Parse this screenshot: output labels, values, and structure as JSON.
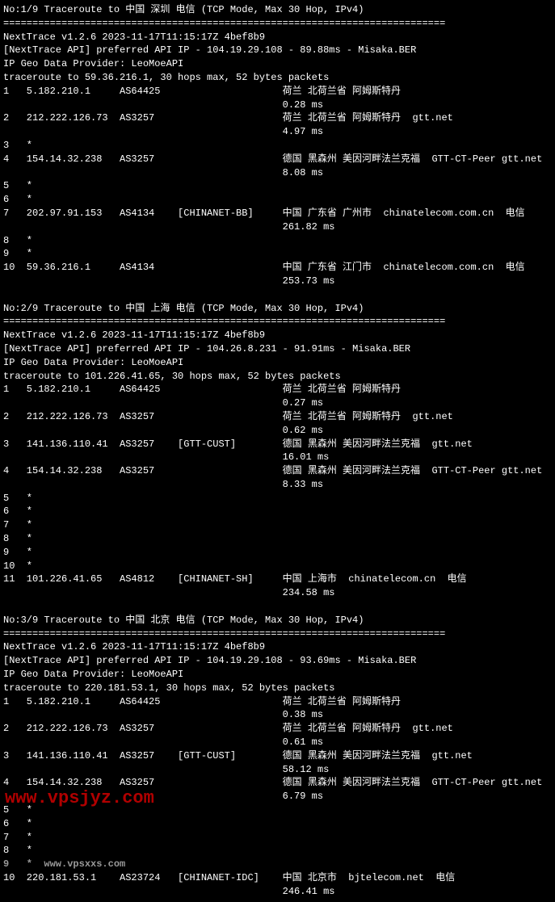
{
  "divider": "============================================================================",
  "traces": [
    {
      "header": "No:1/9 Traceroute to 中国 深圳 电信 (TCP Mode, Max 30 Hop, IPv4)",
      "version": "NextTrace v1.2.6 2023-11-17T11:15:17Z 4bef8b9",
      "api": "[NextTrace API] preferred API IP - 104.19.29.108 - 89.88ms - Misaka.BER",
      "geo": "IP Geo Data Provider: LeoMoeAPI",
      "cmd": "traceroute to 59.36.216.1, 30 hops max, 52 bytes packets",
      "hops": [
        {
          "n": "1",
          "ip": "5.182.210.1",
          "as": "AS64425",
          "tag": "",
          "loc": "荷兰 北荷兰省 阿姆斯特丹",
          "isp": "",
          "ms": "0.28 ms"
        },
        {
          "n": "2",
          "ip": "212.222.126.73",
          "as": "AS3257",
          "tag": "",
          "loc": "荷兰 北荷兰省 阿姆斯特丹",
          "isp": "gtt.net",
          "ms": "4.97 ms"
        },
        {
          "n": "3",
          "ip": "*",
          "as": "",
          "tag": "",
          "loc": "",
          "isp": "",
          "ms": ""
        },
        {
          "n": "4",
          "ip": "154.14.32.238",
          "as": "AS3257",
          "tag": "",
          "loc": "德国 黑森州 美因河畔法兰克福",
          "isp": "GTT-CT-Peer gtt.net",
          "ms": "8.08 ms"
        },
        {
          "n": "5",
          "ip": "*",
          "as": "",
          "tag": "",
          "loc": "",
          "isp": "",
          "ms": ""
        },
        {
          "n": "6",
          "ip": "*",
          "as": "",
          "tag": "",
          "loc": "",
          "isp": "",
          "ms": ""
        },
        {
          "n": "7",
          "ip": "202.97.91.153",
          "as": "AS4134",
          "tag": "[CHINANET-BB]",
          "loc": "中国 广东省 广州市",
          "isp": "chinatelecom.com.cn  电信",
          "ms": "261.82 ms"
        },
        {
          "n": "8",
          "ip": "*",
          "as": "",
          "tag": "",
          "loc": "",
          "isp": "",
          "ms": ""
        },
        {
          "n": "9",
          "ip": "*",
          "as": "",
          "tag": "",
          "loc": "",
          "isp": "",
          "ms": ""
        },
        {
          "n": "10",
          "ip": "59.36.216.1",
          "as": "AS4134",
          "tag": "",
          "loc": "中国 广东省 江门市",
          "isp": "chinatelecom.com.cn  电信",
          "ms": "253.73 ms"
        }
      ]
    },
    {
      "header": "No:2/9 Traceroute to 中国 上海 电信 (TCP Mode, Max 30 Hop, IPv4)",
      "version": "NextTrace v1.2.6 2023-11-17T11:15:17Z 4bef8b9",
      "api": "[NextTrace API] preferred API IP - 104.26.8.231 - 91.91ms - Misaka.BER",
      "geo": "IP Geo Data Provider: LeoMoeAPI",
      "cmd": "traceroute to 101.226.41.65, 30 hops max, 52 bytes packets",
      "hops": [
        {
          "n": "1",
          "ip": "5.182.210.1",
          "as": "AS64425",
          "tag": "",
          "loc": "荷兰 北荷兰省 阿姆斯特丹",
          "isp": "",
          "ms": "0.27 ms"
        },
        {
          "n": "2",
          "ip": "212.222.126.73",
          "as": "AS3257",
          "tag": "",
          "loc": "荷兰 北荷兰省 阿姆斯特丹",
          "isp": "gtt.net",
          "ms": "0.62 ms"
        },
        {
          "n": "3",
          "ip": "141.136.110.41",
          "as": "AS3257",
          "tag": "[GTT-CUST]",
          "loc": "德国 黑森州 美因河畔法兰克福",
          "isp": "gtt.net",
          "ms": "16.01 ms"
        },
        {
          "n": "4",
          "ip": "154.14.32.238",
          "as": "AS3257",
          "tag": "",
          "loc": "德国 黑森州 美因河畔法兰克福",
          "isp": "GTT-CT-Peer gtt.net",
          "ms": "8.33 ms"
        },
        {
          "n": "5",
          "ip": "*",
          "as": "",
          "tag": "",
          "loc": "",
          "isp": "",
          "ms": ""
        },
        {
          "n": "6",
          "ip": "*",
          "as": "",
          "tag": "",
          "loc": "",
          "isp": "",
          "ms": ""
        },
        {
          "n": "7",
          "ip": "*",
          "as": "",
          "tag": "",
          "loc": "",
          "isp": "",
          "ms": ""
        },
        {
          "n": "8",
          "ip": "*",
          "as": "",
          "tag": "",
          "loc": "",
          "isp": "",
          "ms": ""
        },
        {
          "n": "9",
          "ip": "*",
          "as": "",
          "tag": "",
          "loc": "",
          "isp": "",
          "ms": ""
        },
        {
          "n": "10",
          "ip": "*",
          "as": "",
          "tag": "",
          "loc": "",
          "isp": "",
          "ms": ""
        },
        {
          "n": "11",
          "ip": "101.226.41.65",
          "as": "AS4812",
          "tag": "[CHINANET-SH]",
          "loc": "中国 上海市",
          "isp": "chinatelecom.cn  电信",
          "ms": "234.58 ms"
        }
      ]
    },
    {
      "header": "No:3/9 Traceroute to 中国 北京 电信 (TCP Mode, Max 30 Hop, IPv4)",
      "version": "NextTrace v1.2.6 2023-11-17T11:15:17Z 4bef8b9",
      "api": "[NextTrace API] preferred API IP - 104.19.29.108 - 93.69ms - Misaka.BER",
      "geo": "IP Geo Data Provider: LeoMoeAPI",
      "cmd": "traceroute to 220.181.53.1, 30 hops max, 52 bytes packets",
      "hops": [
        {
          "n": "1",
          "ip": "5.182.210.1",
          "as": "AS64425",
          "tag": "",
          "loc": "荷兰 北荷兰省 阿姆斯特丹",
          "isp": "",
          "ms": "0.38 ms"
        },
        {
          "n": "2",
          "ip": "212.222.126.73",
          "as": "AS3257",
          "tag": "",
          "loc": "荷兰 北荷兰省 阿姆斯特丹",
          "isp": "gtt.net",
          "ms": "0.61 ms"
        },
        {
          "n": "3",
          "ip": "141.136.110.41",
          "as": "AS3257",
          "tag": "[GTT-CUST]",
          "loc": "德国 黑森州 美因河畔法兰克福",
          "isp": "gtt.net",
          "ms": "58.12 ms"
        },
        {
          "n": "4",
          "ip": "154.14.32.238",
          "as": "AS3257",
          "tag": "",
          "loc": "德国 黑森州 美因河畔法兰克福",
          "isp": "GTT-CT-Peer gtt.net",
          "ms": "6.79 ms"
        },
        {
          "n": "5",
          "ip": "*",
          "as": "",
          "tag": "",
          "loc": "",
          "isp": "",
          "ms": ""
        },
        {
          "n": "6",
          "ip": "*",
          "as": "",
          "tag": "",
          "loc": "",
          "isp": "",
          "ms": ""
        },
        {
          "n": "7",
          "ip": "*",
          "as": "",
          "tag": "",
          "loc": "",
          "isp": "",
          "ms": ""
        },
        {
          "n": "8",
          "ip": "*",
          "as": "",
          "tag": "",
          "loc": "",
          "isp": "",
          "ms": ""
        },
        {
          "n": "10",
          "ip": "220.181.53.1",
          "as": "AS23724",
          "tag": "[CHINANET-IDC]",
          "loc": "中国 北京市",
          "isp": "bjtelecom.net  电信",
          "ms": "246.41 ms"
        }
      ]
    }
  ],
  "watermark1": "9   *  www.vpsxxs.com",
  "watermark2": "www.vpsjyz.com"
}
